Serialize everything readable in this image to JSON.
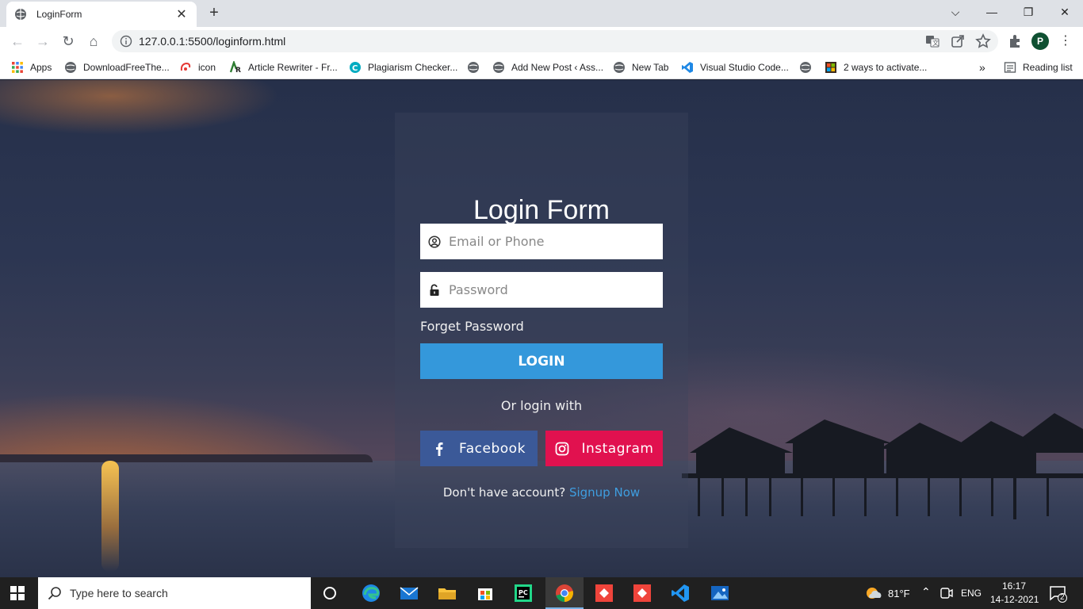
{
  "browser": {
    "tab_title": "LoginForm",
    "url": "127.0.0.1:5500/loginform.html",
    "profile_initial": "P",
    "bookmarks": [
      {
        "label": "Apps",
        "icon": "apps-grid-icon"
      },
      {
        "label": "DownloadFreeThe...",
        "icon": "globe-icon"
      },
      {
        "label": "icon",
        "icon": "swirl-icon"
      },
      {
        "label": "Article Rewriter - Fr...",
        "icon": "rewriter-icon"
      },
      {
        "label": "Plagiarism Checker...",
        "icon": "checker-icon"
      },
      {
        "label": "",
        "icon": "globe-icon"
      },
      {
        "label": "Add New Post ‹ Ass...",
        "icon": "globe-icon"
      },
      {
        "label": "New Tab",
        "icon": "globe-icon"
      },
      {
        "label": "Visual Studio Code...",
        "icon": "vscode-icon"
      },
      {
        "label": "",
        "icon": "globe-icon"
      },
      {
        "label": "2 ways to activate...",
        "icon": "windows-icon"
      }
    ],
    "reading_list": "Reading list",
    "more_bookmarks": "»"
  },
  "login": {
    "title": "Login Form",
    "email_placeholder": "Email or Phone",
    "password_placeholder": "Password",
    "forget": "Forget Password",
    "login_button": "LOGIN",
    "or_text": "Or login with",
    "facebook": "Facebook",
    "instagram": "Instagram",
    "no_account": "Don't have account?",
    "signup": "Signup Now"
  },
  "taskbar": {
    "search_placeholder": "Type here to search",
    "weather": "81°F",
    "language": "ENG",
    "time": "16:17",
    "date": "14-12-2021",
    "notifications": "2"
  },
  "colors": {
    "login_button": "#3498db",
    "facebook": "#3b5998",
    "instagram": "#e1114f",
    "signup_link": "#3f9ee0"
  }
}
